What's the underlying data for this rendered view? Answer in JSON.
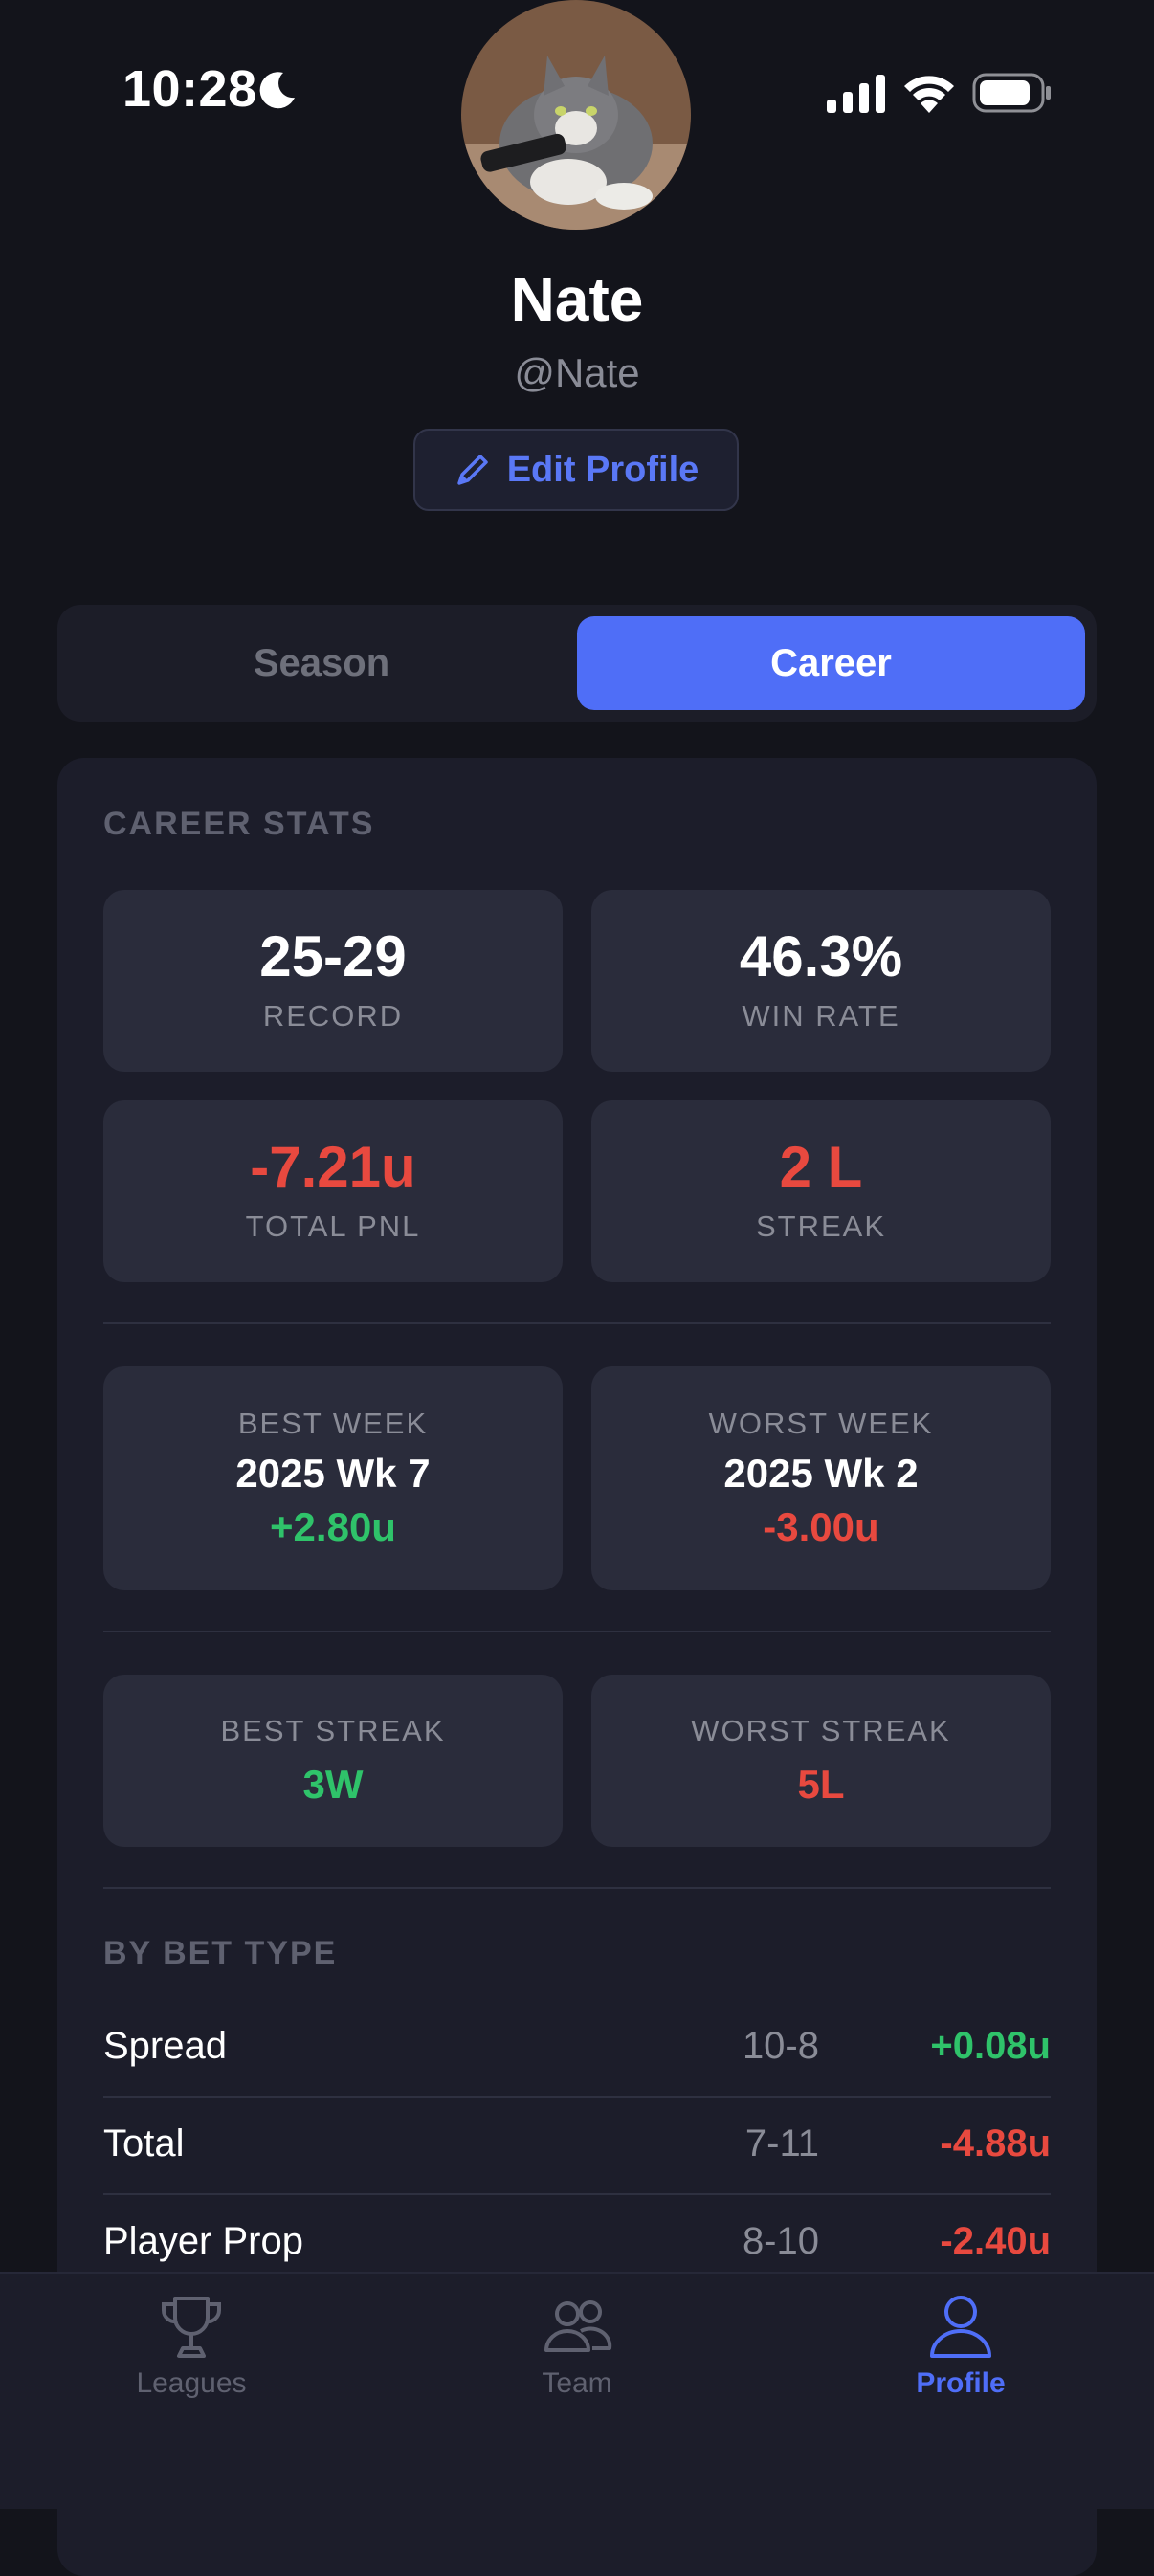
{
  "status_bar": {
    "time": "10:28"
  },
  "profile": {
    "name": "Nate",
    "handle": "@Nate",
    "edit_label": "Edit Profile"
  },
  "segments": {
    "season": "Season",
    "career": "Career",
    "selected": "Career"
  },
  "career_stats": {
    "title": "CAREER STATS",
    "record": {
      "value": "25-29",
      "label": "RECORD"
    },
    "win_rate": {
      "value": "46.3%",
      "label": "WIN RATE"
    },
    "total_pnl": {
      "value": "-7.21u",
      "label": "TOTAL PNL"
    },
    "streak": {
      "value": "2 L",
      "label": "STREAK"
    },
    "best_week": {
      "label": "BEST WEEK",
      "week": "2025 Wk 7",
      "pnl": "+2.80u"
    },
    "worst_week": {
      "label": "WORST WEEK",
      "week": "2025 Wk 2",
      "pnl": "-3.00u"
    },
    "best_streak": {
      "label": "BEST STREAK",
      "value": "3W"
    },
    "worst_streak": {
      "label": "WORST STREAK",
      "value": "5L"
    }
  },
  "by_bet_type": {
    "title": "BY BET TYPE",
    "rows": [
      {
        "type": "Spread",
        "record": "10-8",
        "pnl": "+0.08u"
      },
      {
        "type": "Total",
        "record": "7-11",
        "pnl": "-4.88u"
      },
      {
        "type": "Player Prop",
        "record": "8-10",
        "pnl": "-2.40u"
      }
    ]
  },
  "tabbar": {
    "leagues": "Leagues",
    "team": "Team",
    "profile": "Profile",
    "active": "Profile"
  },
  "colors": {
    "accent": "#4f6ef7",
    "positive": "#2fc36a",
    "negative": "#e8493f",
    "background": "#13141b",
    "card": "#1c1d2a",
    "tile": "#2a2c3b"
  },
  "icons": {
    "moon": "moon-icon",
    "signal": "cellular-signal-icon",
    "wifi": "wifi-icon",
    "battery": "battery-icon",
    "edit": "pencil-icon",
    "leagues": "trophy-icon",
    "team": "people-icon",
    "profile": "person-icon"
  }
}
